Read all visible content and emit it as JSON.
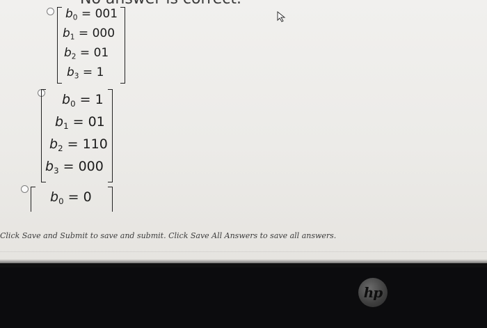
{
  "header": {
    "cut_text": "No answer is correct."
  },
  "options": [
    {
      "rows": [
        {
          "var": "b",
          "sub": "0",
          "value": "001"
        },
        {
          "var": "b",
          "sub": "1",
          "value": "000"
        },
        {
          "var": "b",
          "sub": "2",
          "value": "01"
        },
        {
          "var": "b",
          "sub": "3",
          "value": "1"
        }
      ]
    },
    {
      "rows": [
        {
          "var": "b",
          "sub": "0",
          "value": "1"
        },
        {
          "var": "b",
          "sub": "1",
          "value": "01"
        },
        {
          "var": "b",
          "sub": "2",
          "value": "110"
        },
        {
          "var": "b",
          "sub": "3",
          "value": "000"
        }
      ]
    },
    {
      "rows": [
        {
          "var": "b",
          "sub": "0",
          "value": "0"
        }
      ]
    }
  ],
  "instruction": "Click Save and Submit to save and submit. Click Save All Answers to save all answers.",
  "logo": {
    "text": "hp"
  },
  "icons": {
    "cursor": "mouse-pointer-icon",
    "radio": "radio-button"
  }
}
